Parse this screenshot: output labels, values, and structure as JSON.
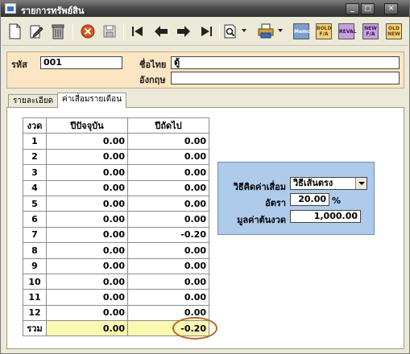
{
  "window": {
    "title": "รายการทรัพย์สิน",
    "min_glyph": "_",
    "max_glyph": "□",
    "close_glyph": "✕"
  },
  "toolbar": {
    "buttons": [
      "new-doc-icon",
      "edit-icon",
      "trash-icon",
      "cancel-icon",
      "save-icon",
      "first-record-icon",
      "prev-record-icon",
      "next-record-icon",
      "last-record-icon",
      "search-icon",
      "print-icon",
      "memo-icon",
      "bold-fa-icon",
      "reval-icon",
      "new-fa-icon"
    ],
    "memo_label": "Memo",
    "bold_label1": "BOLD",
    "bold_label2": "F/A",
    "reval_label": "REVAL",
    "new_label1": "NEW",
    "new_label2": "F/A",
    "old_label1": "OLD",
    "old_label2": "NEW"
  },
  "header": {
    "code_label": "รหัส",
    "code_value": "001",
    "thai_name_label": "ชื่อไทย",
    "thai_name_value": "ตู้",
    "eng_name_label": "อังกฤษ",
    "eng_name_value": ""
  },
  "tabs": [
    {
      "label": "รายละเอียด"
    },
    {
      "label": "ค่าเสื่อมรายเดือน"
    }
  ],
  "grid": {
    "headers": [
      "งวด",
      "ปีปัจจุบัน",
      "ปีถัดไป"
    ],
    "rows": [
      {
        "period": "1",
        "current": "0.00",
        "next": "0.00"
      },
      {
        "period": "2",
        "current": "0.00",
        "next": "0.00"
      },
      {
        "period": "3",
        "current": "0.00",
        "next": "0.00"
      },
      {
        "period": "4",
        "current": "0.00",
        "next": "0.00"
      },
      {
        "period": "5",
        "current": "0.00",
        "next": "0.00"
      },
      {
        "period": "6",
        "current": "0.00",
        "next": "0.00"
      },
      {
        "period": "7",
        "current": "0.00",
        "next": "-0.20"
      },
      {
        "period": "8",
        "current": "0.00",
        "next": "0.00"
      },
      {
        "period": "9",
        "current": "0.00",
        "next": "0.00"
      },
      {
        "period": "10",
        "current": "0.00",
        "next": "0.00"
      },
      {
        "period": "11",
        "current": "0.00",
        "next": "0.00"
      },
      {
        "period": "12",
        "current": "0.00",
        "next": "0.00"
      }
    ],
    "total_label": "รวม",
    "total_current": "0.00",
    "total_next": "-0.20"
  },
  "method": {
    "method_label": "วิธีคิดค่าเสื่อม",
    "method_value": "วิธีเส้นตรง",
    "rate_label": "อัตรา",
    "rate_value": "20.00",
    "rate_unit": "%",
    "start_value_label": "มูลค่าต้นงวด",
    "start_value": "1,000.00"
  },
  "colors": {
    "header_bg": "#fbe6c3",
    "method_bg": "#aecbec",
    "total_bg": "#fbf8b2",
    "highlight": "#b7691f"
  }
}
